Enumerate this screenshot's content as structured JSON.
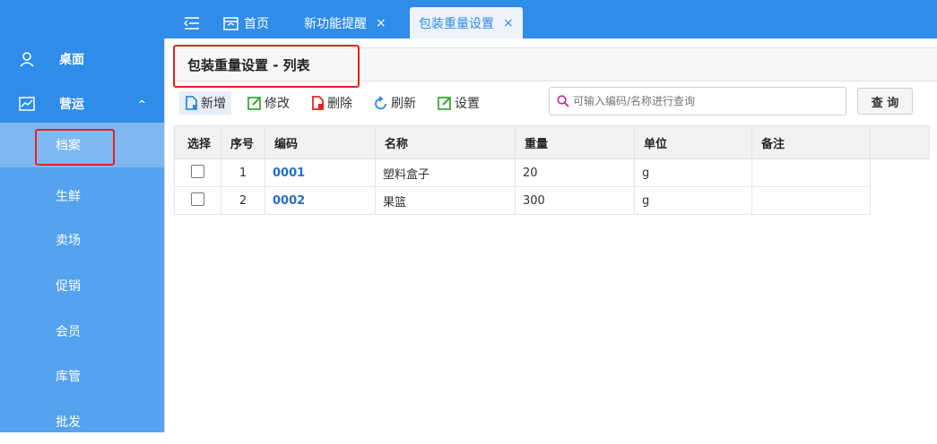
{
  "sidebar": {
    "items": [
      {
        "label": "桌面",
        "icon": "user-icon"
      },
      {
        "label": "营运",
        "icon": "chart-icon",
        "caret": "^"
      }
    ],
    "submenu": [
      "档案",
      "生鲜",
      "卖场",
      "促销",
      "会员",
      "库管",
      "批发"
    ],
    "active_submenu": "档案"
  },
  "topbar": {
    "tabs": [
      {
        "label": "首页"
      },
      {
        "label": "新功能提醒",
        "close": "×"
      },
      {
        "label": "包装重量设置",
        "close": "×"
      }
    ]
  },
  "page": {
    "title": "包装重量设置 - 列表"
  },
  "toolbar": {
    "add_label": "新增",
    "edit_label": "修改",
    "delete_label": "删除",
    "refresh_label": "刷新",
    "settings_label": "设置",
    "search_placeholder": "可输入编码/名称进行查询",
    "query_label": "查 询"
  },
  "table": {
    "headers": [
      "选择",
      "序号",
      "编码",
      "名称",
      "重量",
      "单位",
      "备注"
    ],
    "rows": [
      {
        "seq": "1",
        "code": "0001",
        "name": "塑料盒子",
        "weight": "20",
        "unit": "g",
        "remark": ""
      },
      {
        "seq": "2",
        "code": "0002",
        "name": "果篮",
        "weight": "300",
        "unit": "g",
        "remark": ""
      }
    ]
  },
  "colors": {
    "primary": "#2f8ce8",
    "submenu_bg": "#55a2ee",
    "highlight_box": "#e3231d",
    "code_text": "#2571c5"
  }
}
